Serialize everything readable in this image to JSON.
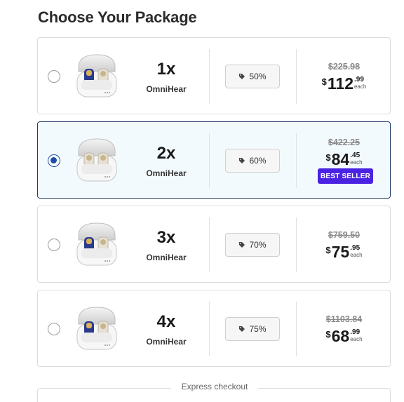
{
  "title": "Choose Your Package",
  "express_label": "Express checkout",
  "packages": [
    {
      "qty": "1x",
      "name": "OmniHear",
      "discount": "50%",
      "old_price": "$225.98",
      "currency": "$",
      "price_whole": "112",
      "price_cents": ".99",
      "each": "each",
      "selected": false,
      "badge": ""
    },
    {
      "qty": "2x",
      "name": "OmniHear",
      "discount": "60%",
      "old_price": "$422.25",
      "currency": "$",
      "price_whole": "84",
      "price_cents": ".45",
      "each": "each",
      "selected": true,
      "badge": "BEST SELLER"
    },
    {
      "qty": "3x",
      "name": "OmniHear",
      "discount": "70%",
      "old_price": "$759.50",
      "currency": "$",
      "price_whole": "75",
      "price_cents": ".95",
      "each": "each",
      "selected": false,
      "badge": ""
    },
    {
      "qty": "4x",
      "name": "OmniHear",
      "discount": "75%",
      "old_price": "$1103.84",
      "currency": "$",
      "price_whole": "68",
      "price_cents": ".99",
      "each": "each",
      "selected": false,
      "badge": ""
    }
  ],
  "icons": {
    "discount": "tag-icon",
    "product": "earbuds-case-image"
  }
}
